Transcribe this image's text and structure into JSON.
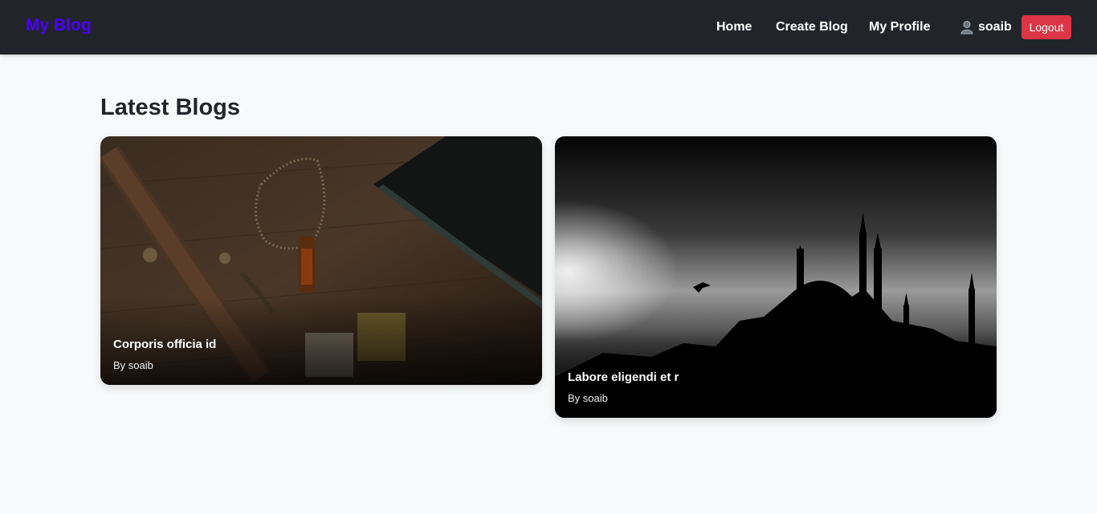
{
  "nav": {
    "brand": "My Blog",
    "links": [
      "Home",
      "Create Blog",
      "My Profile"
    ],
    "username": "soaib",
    "logout_label": "Logout"
  },
  "main": {
    "heading": "Latest Blogs",
    "blogs": [
      {
        "title": "Corporis officia id",
        "author": "By soaib"
      },
      {
        "title": "Labore eligendi et r",
        "author": "By soaib"
      }
    ]
  },
  "colors": {
    "brand": "#4b00ff",
    "navbar": "#212529",
    "logout": "#dc3545",
    "page_bg": "#f8f9fa"
  }
}
